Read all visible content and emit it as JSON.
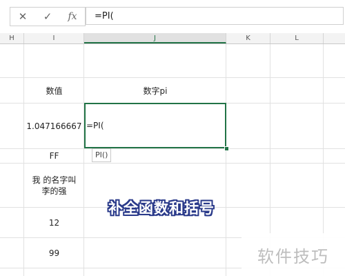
{
  "formula_bar": {
    "cancel_icon": "✕",
    "enter_icon": "✓",
    "fx_icon": "fx",
    "formula": "=PI("
  },
  "columns": [
    "H",
    "I",
    "J",
    "K",
    "L"
  ],
  "cells": {
    "header_value": "数值",
    "header_pi": "数字pi",
    "i_row2": "1.047166667",
    "active_cell_content": "=PI(",
    "i_row3": "FF",
    "i_row4": "我    的名字叫李的强",
    "i_row5": "12",
    "i_row6": "99"
  },
  "tooltip": "PI()",
  "overlay_caption": "补全函数和括号",
  "watermark": "软件技巧",
  "colors": {
    "accent": "#217346",
    "caption_outline": "#2a3a8a"
  }
}
